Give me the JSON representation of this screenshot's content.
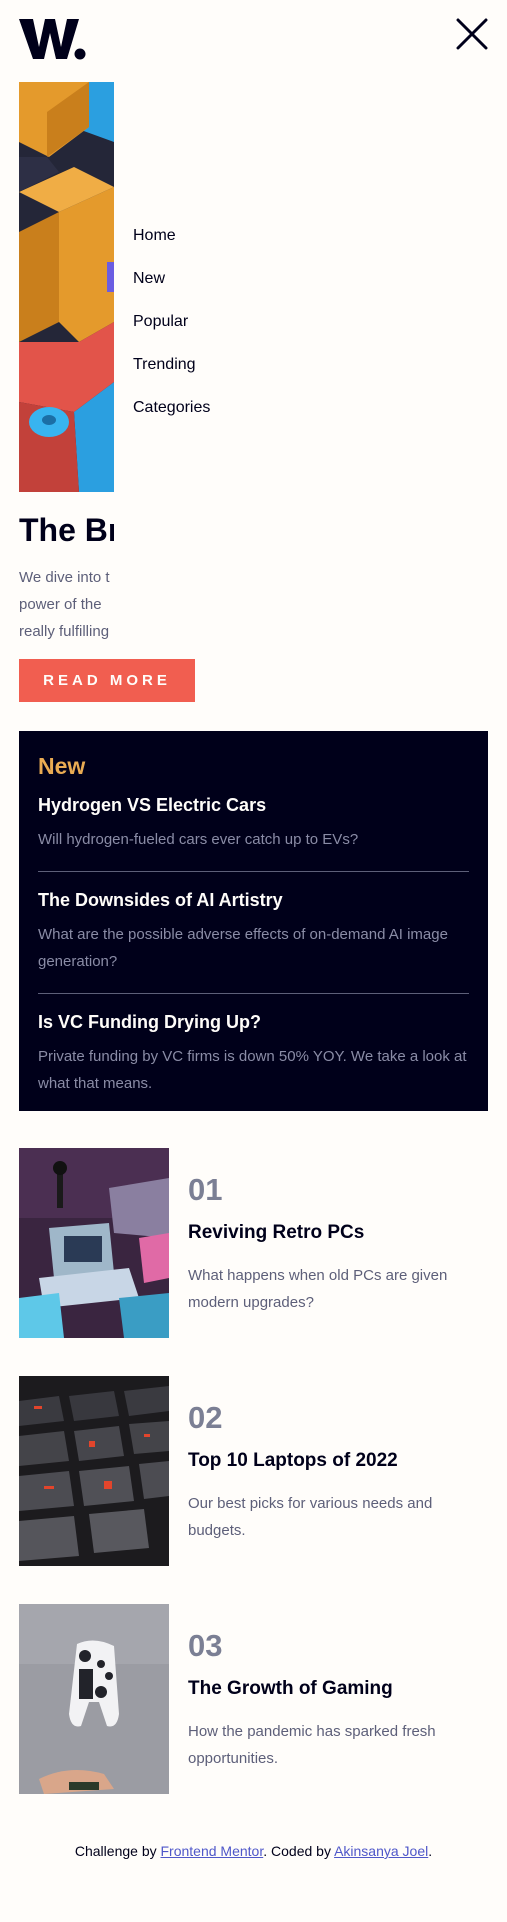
{
  "brand": {
    "logo_text": "W."
  },
  "menu": {
    "items": [
      {
        "label": "Home"
      },
      {
        "label": "New"
      },
      {
        "label": "Popular"
      },
      {
        "label": "Trending"
      },
      {
        "label": "Categories"
      }
    ]
  },
  "hero": {
    "title": "The Br",
    "text_lines": [
      "We dive into t",
      "power of the",
      "really fulfilling"
    ],
    "button_label": "READ MORE"
  },
  "new_section": {
    "heading": "New",
    "items": [
      {
        "title": "Hydrogen VS Electric Cars",
        "desc": "Will hydrogen-fueled cars ever catch up to EVs?"
      },
      {
        "title": "The Downsides of AI Artistry",
        "desc": "What are the possible adverse effects of on-demand AI image generation?"
      },
      {
        "title": "Is VC Funding Drying Up?",
        "desc": "Private funding by VC firms is down 50% YOY. We take a look at what that means."
      }
    ]
  },
  "articles": [
    {
      "number": "01",
      "title": "Reviving Retro PCs",
      "desc": "What happens when old PCs are given modern upgrades?"
    },
    {
      "number": "02",
      "title": "Top 10 Laptops of 2022",
      "desc": "Our best picks for various needs and budgets."
    },
    {
      "number": "03",
      "title": "The Growth of Gaming",
      "desc": "How the pandemic has sparked fresh opportunities."
    }
  ],
  "footer": {
    "prefix": "Challenge by ",
    "link1": "Frontend Mentor",
    "middle": ". Coded by ",
    "link2": "Akinsanya Joel",
    "suffix": "."
  },
  "colors": {
    "accent_red": "#f15e50",
    "accent_orange": "#e9ab53",
    "dark_navy": "#00001a",
    "off_white": "#fffdfa",
    "grayish_blue": "#5d5f79"
  }
}
